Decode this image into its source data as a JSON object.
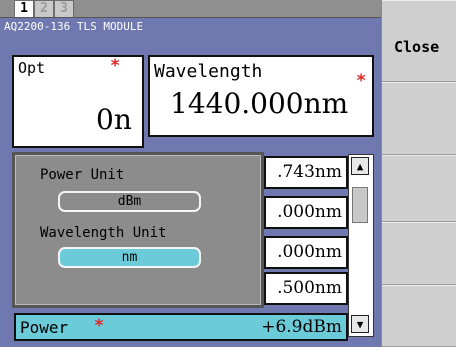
{
  "tabs": [
    "1",
    "2",
    "3"
  ],
  "module_title": "AQ2200-136 TLS MODULE",
  "opt": {
    "label": "Opt",
    "value": "0n"
  },
  "wavelength": {
    "label": "Wavelength",
    "value": "1440.000nm"
  },
  "required_mark": "*",
  "list_values": [
    ".743nm",
    ".000nm",
    ".000nm",
    ".500nm"
  ],
  "power": {
    "label": "Power",
    "value": "+6.9dBm"
  },
  "popup": {
    "power_unit_label": "Power Unit",
    "power_unit_value": "dBm",
    "wavelength_unit_label": "Wavelength Unit",
    "wavelength_unit_value": "nm"
  },
  "softkeys": {
    "close_label": "Close"
  },
  "icons": {
    "scroll_up": "▲",
    "scroll_down": "▼"
  },
  "colors": {
    "panel": "#6f79b0",
    "selected": "#6ccbd8",
    "required": "#e32626"
  }
}
